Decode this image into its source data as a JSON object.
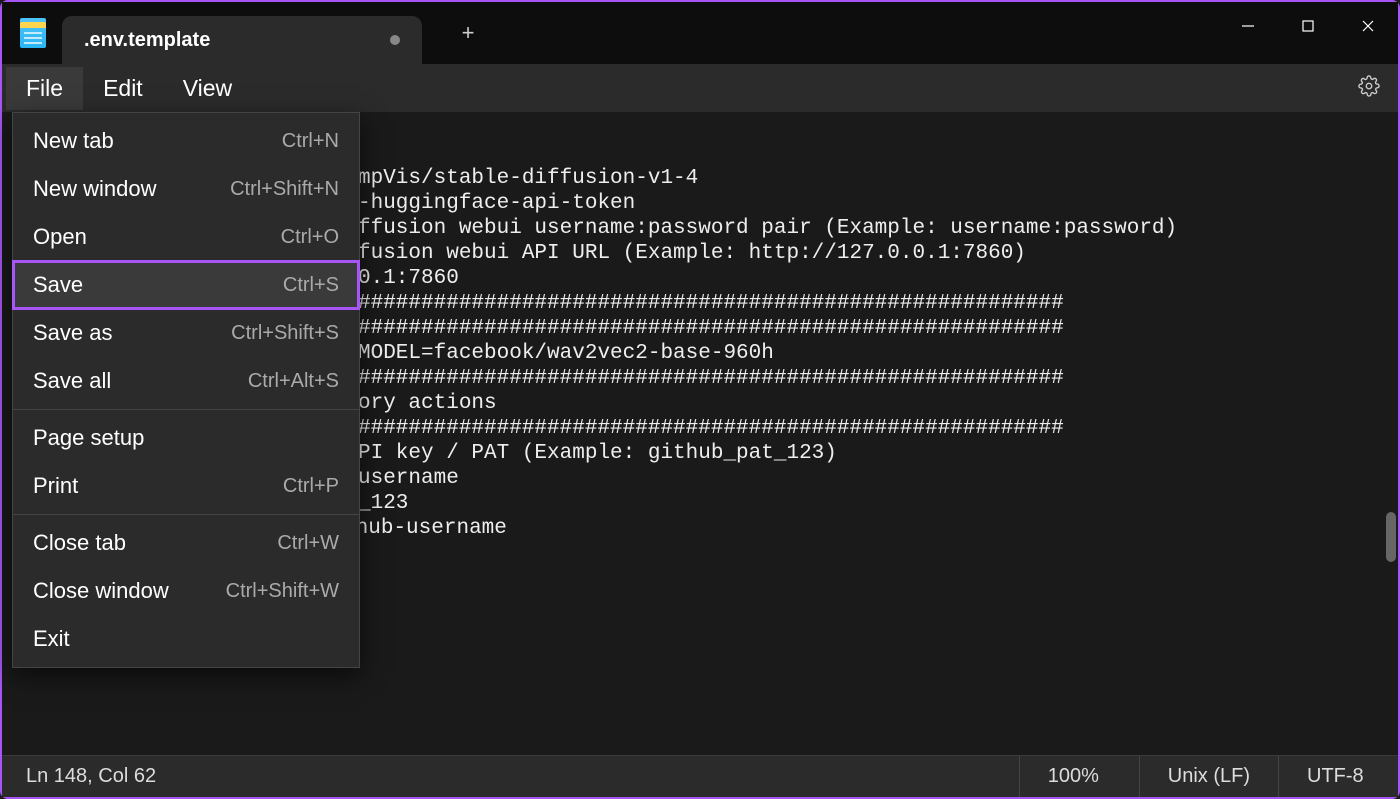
{
  "tab": {
    "title": ".env.template",
    "modified": true
  },
  "menubar": {
    "file": "File",
    "edit": "Edit",
    "view": "View"
  },
  "file_menu": {
    "new_tab": {
      "label": "New tab",
      "shortcut": "Ctrl+N"
    },
    "new_window": {
      "label": "New window",
      "shortcut": "Ctrl+Shift+N"
    },
    "open": {
      "label": "Open",
      "shortcut": "Ctrl+O"
    },
    "save": {
      "label": "Save",
      "shortcut": "Ctrl+S"
    },
    "save_as": {
      "label": "Save as",
      "shortcut": "Ctrl+Shift+S"
    },
    "save_all": {
      "label": "Save all",
      "shortcut": "Ctrl+Alt+S"
    },
    "page_setup": {
      "label": "Page setup",
      "shortcut": ""
    },
    "print": {
      "label": "Print",
      "shortcut": "Ctrl+P"
    },
    "close_tab": {
      "label": "Close tab",
      "shortcut": "Ctrl+W"
    },
    "close_window": {
      "label": "Close window",
      "shortcut": "Ctrl+Shift+W"
    },
    "exit": {
      "label": "Exit",
      "shortcut": ""
    }
  },
  "editor": {
    "content": "mpVis/stable-diffusion-v1-4\n-huggingface-api-token\n\n\nffusion webui username:password pair (Example: username:password)\nfusion webui API URL (Example: http://127.0.0.1:7860)\n\n0.1:7860\n\n########################################################\n\n########################################################\n\n\nMODEL=facebook/wav2vec2-base-960h\n\n########################################################\nory actions\n########################################################\n\n\nPI key / PAT (Example: github_pat_123)\nusername\n_123\n# GITHUB_USERNAME=your-github-username"
  },
  "statusbar": {
    "position": "Ln 148, Col 62",
    "zoom": "100%",
    "eol": "Unix (LF)",
    "encoding": "UTF-8"
  },
  "icons": {
    "new_tab_plus": "+"
  }
}
